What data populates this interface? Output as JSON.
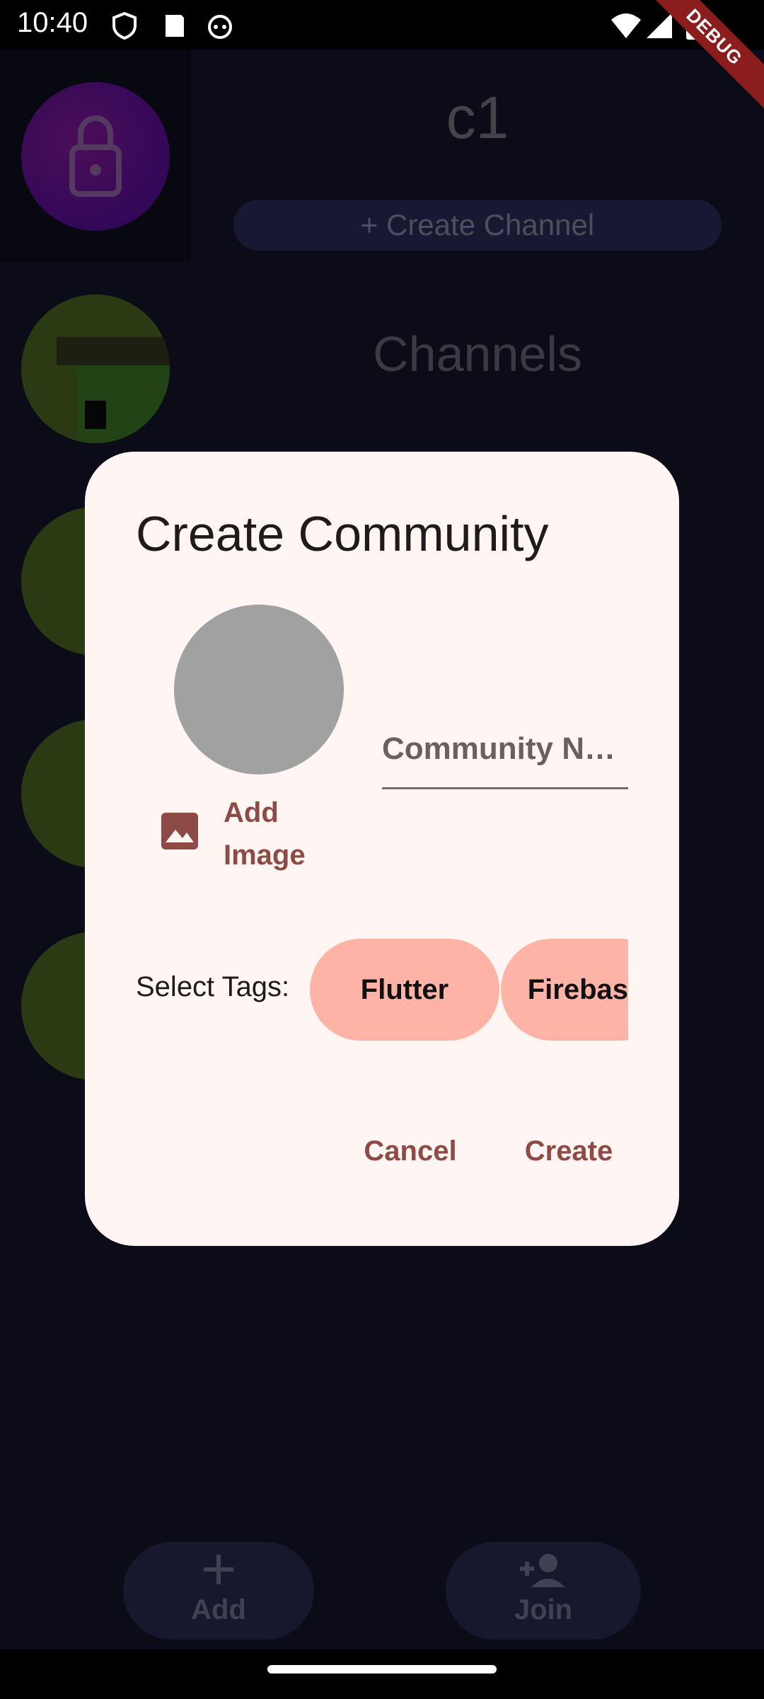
{
  "status_bar": {
    "time": "10:40",
    "icons": [
      "shield-icon",
      "sd-card-icon",
      "cat-icon",
      "wifi-icon",
      "signal-icon",
      "battery-icon"
    ],
    "debug_banner": "DEBUG"
  },
  "background": {
    "channel_title": "c1",
    "create_channel_label": "+ Create Channel",
    "channels_heading": "Channels"
  },
  "dialog": {
    "title": "Create Community",
    "add_image_label": "Add Image",
    "name_placeholder": "Community N…",
    "name_value": "",
    "tags_label": "Select Tags:",
    "tags": [
      "Flutter",
      "Firebase"
    ],
    "cancel_label": "Cancel",
    "create_label": "Create"
  },
  "bottom_actions": {
    "add_label": "Add",
    "join_label": "Join"
  },
  "colors": {
    "dialog_bg": "#fff6f4",
    "accent": "#8e4a44",
    "chip": "#ffb3a7",
    "app_bg": "#16162e"
  }
}
